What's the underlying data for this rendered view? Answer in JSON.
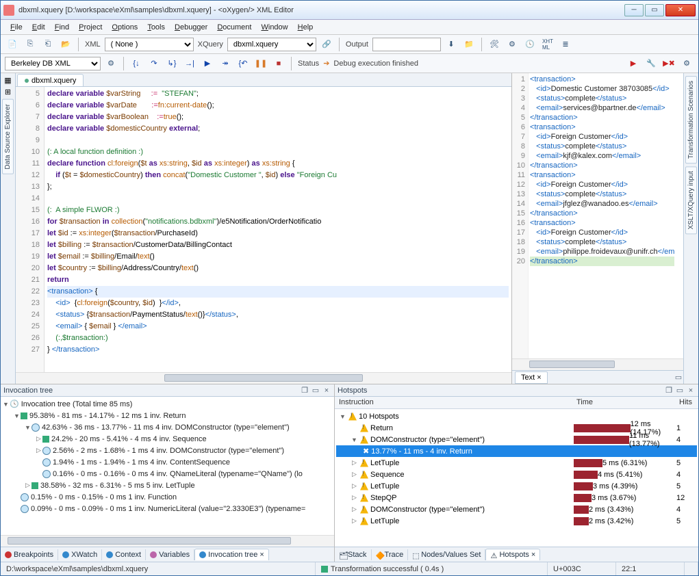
{
  "title": "dbxml.xquery [D:\\workspace\\eXml\\samples\\dbxml.xquery] - <oXygen/> XML Editor",
  "menu": [
    "File",
    "Edit",
    "Find",
    "Project",
    "Options",
    "Tools",
    "Debugger",
    "Document",
    "Window",
    "Help"
  ],
  "toolbar1": {
    "xml_label": "XML",
    "xml_value": "( None )",
    "xquery_label": "XQuery",
    "xquery_value": "dbxml.xquery",
    "output_label": "Output",
    "output_value": ""
  },
  "toolbar2": {
    "profile": "Berkeley DB XML",
    "status_label": "Status",
    "status_value": "Debug execution finished"
  },
  "editor_tab": "dbxml.xquery",
  "code_lines": [
    {
      "n": 5,
      "html": "<span class='kw'>declare variable</span> <span class='var'>$varString</span>     <span class='op'>:=</span>  <span class='str'>\"STEFAN\"</span>;"
    },
    {
      "n": 6,
      "html": "<span class='kw'>declare variable</span> <span class='var'>$varDate</span>       <span class='op'>:=</span><span class='fn'>fn:current-date</span>();"
    },
    {
      "n": 7,
      "html": "<span class='kw'>declare variable</span> <span class='var'>$varBoolean</span>    <span class='op'>:=</span><span class='fn'>true</span>();"
    },
    {
      "n": 8,
      "html": "<span class='kw'>declare variable</span> <span class='var'>$domesticCountry</span> <span class='kw'>external</span>;"
    },
    {
      "n": 9,
      "html": ""
    },
    {
      "n": 10,
      "html": "<span class='cmt'>(: A local function definition :)</span>"
    },
    {
      "n": 11,
      "html": "<span class='kw'>declare function</span> <span class='fn'>cl:foreign</span>(<span class='var'>$t</span> <span class='kw'>as</span> <span class='fn'>xs:string</span>, <span class='var'>$id</span> <span class='kw'>as</span> <span class='fn'>xs:integer</span>) <span class='kw'>as</span> <span class='fn'>xs:string</span> {"
    },
    {
      "n": 12,
      "html": "    <span class='kw'>if</span> (<span class='var'>$t</span> = <span class='var'>$domesticCountry</span>) <span class='kw'>then</span> <span class='fn'>concat</span>(<span class='str'>\"Domestic Customer \"</span>, <span class='var'>$id</span>) <span class='kw'>else</span> <span class='str'>\"Foreign Cu</span>"
    },
    {
      "n": 13,
      "html": "};"
    },
    {
      "n": 14,
      "html": ""
    },
    {
      "n": 15,
      "html": "<span class='cmt'>(:  A simple FLWOR :)</span>"
    },
    {
      "n": 16,
      "html": "<span class='kw'>for</span> <span class='var'>$transaction</span> <span class='kw'>in</span> <span class='fn'>collection</span>(<span class='str'>\"notifications.bdbxml\"</span>)/e5Notification/OrderNotificatio"
    },
    {
      "n": 17,
      "html": "<span class='kw'>let</span> <span class='var'>$id</span> := <span class='fn'>xs:integer</span>(<span class='var'>$transaction</span>/PurchaseId)"
    },
    {
      "n": 18,
      "html": "<span class='kw'>let</span> <span class='var'>$billing</span> := <span class='var'>$transaction</span>/CustomerData/BillingContact"
    },
    {
      "n": 19,
      "html": "<span class='kw'>let</span> <span class='var'>$email</span> := <span class='var'>$billing</span>/Email/<span class='fn'>text</span>()"
    },
    {
      "n": 20,
      "html": "<span class='kw'>let</span> <span class='var'>$country</span> := <span class='var'>$billing</span>/Address/Country/<span class='fn'>text</span>()"
    },
    {
      "n": 21,
      "html": "<span class='kw'>return</span>"
    },
    {
      "n": 22,
      "html": "<span class='tag'>&lt;transaction&gt;</span> {",
      "hl": true
    },
    {
      "n": 23,
      "html": "    <span class='tag'>&lt;id&gt;</span>  {<span class='fn'>cl:foreign</span>(<span class='var'>$country</span>, <span class='var'>$id</span>)  }<span class='tag'>&lt;/id&gt;</span>,"
    },
    {
      "n": 24,
      "html": "    <span class='tag'>&lt;status&gt;</span> {<span class='var'>$transaction</span>/PaymentStatus/<span class='fn'>text</span>()}<span class='tag'>&lt;/status&gt;</span>,"
    },
    {
      "n": 25,
      "html": "    <span class='tag'>&lt;email&gt;</span> { <span class='var'>$email</span> } <span class='tag'>&lt;/email&gt;</span>"
    },
    {
      "n": 26,
      "html": "    <span class='cmt'>(:,$transaction:)</span>"
    },
    {
      "n": 27,
      "html": "} <span class='tag'>&lt;/transaction&gt;</span>"
    }
  ],
  "xml_lines": [
    {
      "n": 1,
      "html": "<span class='tg'>&lt;transaction&gt;</span>"
    },
    {
      "n": 2,
      "html": "   <span class='tg'>&lt;id&gt;</span><span class='txt'>Domestic Customer 38703085</span><span class='tg'>&lt;/id&gt;</span>"
    },
    {
      "n": 3,
      "html": "   <span class='tg'>&lt;status&gt;</span><span class='txt'>complete</span><span class='tg'>&lt;/status&gt;</span>"
    },
    {
      "n": 4,
      "html": "   <span class='tg'>&lt;email&gt;</span><span class='txt'>services@bpartner.de</span><span class='tg'>&lt;/email&gt;</span>"
    },
    {
      "n": 5,
      "html": "<span class='tg'>&lt;/transaction&gt;</span>"
    },
    {
      "n": 6,
      "html": "<span class='tg'>&lt;transaction&gt;</span>"
    },
    {
      "n": 7,
      "html": "   <span class='tg'>&lt;id&gt;</span><span class='txt'>Foreign Customer</span><span class='tg'>&lt;/id&gt;</span>"
    },
    {
      "n": 8,
      "html": "   <span class='tg'>&lt;status&gt;</span><span class='txt'>complete</span><span class='tg'>&lt;/status&gt;</span>"
    },
    {
      "n": 9,
      "html": "   <span class='tg'>&lt;email&gt;</span><span class='txt'>kjf@kalex.com</span><span class='tg'>&lt;/email&gt;</span>"
    },
    {
      "n": 10,
      "html": "<span class='tg'>&lt;/transaction&gt;</span>"
    },
    {
      "n": 11,
      "html": "<span class='tg'>&lt;transaction&gt;</span>"
    },
    {
      "n": 12,
      "html": "   <span class='tg'>&lt;id&gt;</span><span class='txt'>Foreign Customer</span><span class='tg'>&lt;/id&gt;</span>"
    },
    {
      "n": 13,
      "html": "   <span class='tg'>&lt;status&gt;</span><span class='txt'>complete</span><span class='tg'>&lt;/status&gt;</span>"
    },
    {
      "n": 14,
      "html": "   <span class='tg'>&lt;email&gt;</span><span class='txt'>jfglez@wanadoo.es</span><span class='tg'>&lt;/email&gt;</span>"
    },
    {
      "n": 15,
      "html": "<span class='tg'>&lt;/transaction&gt;</span>"
    },
    {
      "n": 16,
      "html": "<span class='tg'>&lt;transaction&gt;</span>"
    },
    {
      "n": 17,
      "html": "   <span class='tg'>&lt;id&gt;</span><span class='txt'>Foreign Customer</span><span class='tg'>&lt;/id&gt;</span>"
    },
    {
      "n": 18,
      "html": "   <span class='tg'>&lt;status&gt;</span><span class='txt'>complete</span><span class='tg'>&lt;/status&gt;</span>"
    },
    {
      "n": 19,
      "html": "   <span class='tg'>&lt;email&gt;</span><span class='txt'>philippe.froidevaux@unifr.ch</span><span class='tg'>&lt;/em</span>"
    },
    {
      "n": 20,
      "html": "<span class='tg'>&lt;/transaction&gt;</span>",
      "hl": true
    }
  ],
  "results_tab": "Text",
  "inv": {
    "title": "Invocation tree",
    "root": "Invocation tree (Total time  85 ms)",
    "rows": [
      {
        "d": 1,
        "t": "95.38% - 81 ms - 14.17% - 12 ms 1 inv. Return",
        "ar": "▼",
        "i": "g"
      },
      {
        "d": 2,
        "t": "42.63% - 36 ms - 13.77% - 11 ms 4 inv. DOMConstructor (type=\"element\")",
        "ar": "▼",
        "i": "b"
      },
      {
        "d": 3,
        "t": "24.2% - 20 ms - 5.41% - 4 ms 4 inv. Sequence",
        "ar": "▷",
        "i": "g"
      },
      {
        "d": 3,
        "t": "2.56% - 2 ms - 1.68% - 1 ms 4 inv. DOMConstructor (type=\"element\")",
        "ar": "▷",
        "i": "b"
      },
      {
        "d": 3,
        "t": "1.94% - 1 ms - 1.94% - 1 ms 4 inv. ContentSequence",
        "ar": "",
        "i": "b"
      },
      {
        "d": 3,
        "t": "0.16% - 0 ms - 0.16% - 0 ms 4 inv. QNameLiteral (typename=\"QName\") (lo",
        "ar": "",
        "i": "b"
      },
      {
        "d": 2,
        "t": "38.58% - 32 ms - 6.31% - 5 ms 5 inv. LetTuple",
        "ar": "▷",
        "i": "g"
      },
      {
        "d": 1,
        "t": "0.15% - 0 ms - 0.15% - 0 ms 1 inv. Function",
        "ar": "",
        "i": "b"
      },
      {
        "d": 1,
        "t": "0.09% - 0 ms - 0.09% - 0 ms 1 inv. NumericLiteral (value=\"2.3330E3\") (typename=",
        "ar": "",
        "i": "b"
      }
    ]
  },
  "inv_tabs": [
    "Breakpoints",
    "XWatch",
    "Context",
    "Variables",
    "Invocation tree"
  ],
  "hot": {
    "title": "Hotspots",
    "cols": [
      "Instruction",
      "Time",
      "Hits"
    ],
    "top": "10 Hotspots",
    "rows": [
      {
        "d": 1,
        "ins": "Return",
        "bar": 95,
        "time": "12 ms (14.17%)",
        "hits": "1"
      },
      {
        "d": 1,
        "ins": "DOMConstructor (type=\"element\")",
        "bar": 90,
        "time": "11 ms (13.77%)",
        "hits": "4",
        "ar": "▼"
      },
      {
        "d": 2,
        "ins": "13.77% -  11 ms - 4 inv. Return",
        "sel": true
      },
      {
        "d": 1,
        "ins": "LetTuple",
        "bar": 42,
        "time": "5 ms (6.31%)",
        "hits": "5",
        "ar": "▷"
      },
      {
        "d": 1,
        "ins": "Sequence",
        "bar": 35,
        "time": "4 ms (5.41%)",
        "hits": "4",
        "ar": "▷"
      },
      {
        "d": 1,
        "ins": "LetTuple",
        "bar": 28,
        "time": "3 ms (4.39%)",
        "hits": "5",
        "ar": "▷"
      },
      {
        "d": 1,
        "ins": "StepQP",
        "bar": 26,
        "time": "3 ms (3.67%)",
        "hits": "12",
        "ar": "▷"
      },
      {
        "d": 1,
        "ins": "DOMConstructor (type=\"element\")",
        "bar": 22,
        "time": "2 ms (3.43%)",
        "hits": "4",
        "ar": "▷"
      },
      {
        "d": 1,
        "ins": "LetTuple",
        "bar": 22,
        "time": "2 ms (3.42%)",
        "hits": "5",
        "ar": "▷"
      }
    ]
  },
  "hot_tabs": [
    "Stack",
    "Trace",
    "Nodes/Values Set",
    "Hotspots"
  ],
  "sideL": "Data Source Explorer",
  "sideR": [
    "Transformation Scenarios",
    "XSLT/XQuery input"
  ],
  "status": {
    "path": "D:\\workspace\\eXml\\samples\\dbxml.xquery",
    "msg": "Transformation successful  ( 0.4s )",
    "char": "U+003C",
    "pos": "22:1"
  }
}
